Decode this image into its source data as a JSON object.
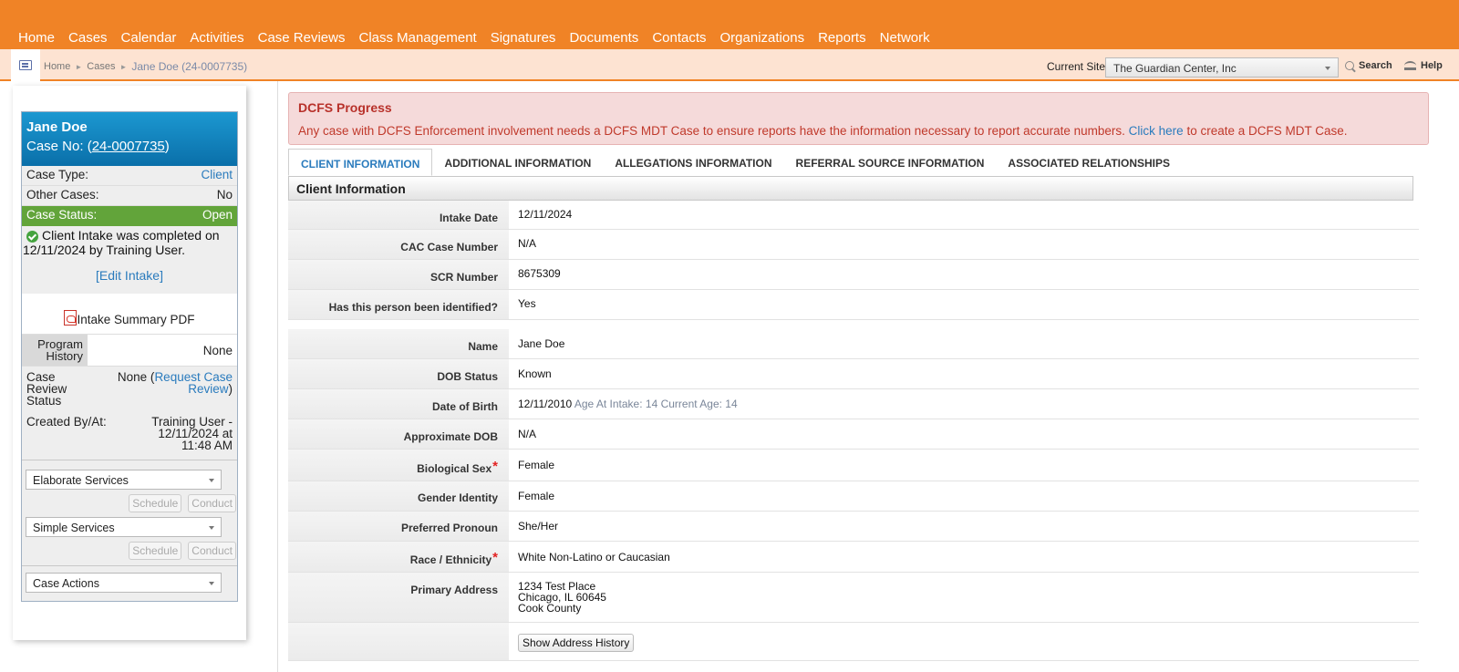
{
  "nav": [
    "Home",
    "Cases",
    "Calendar",
    "Activities",
    "Case Reviews",
    "Class Management",
    "Signatures",
    "Documents",
    "Contacts",
    "Organizations",
    "Reports",
    "Network"
  ],
  "breadcrumb": {
    "home": "Home",
    "cases": "Cases",
    "current": "Jane Doe (24-0007735)"
  },
  "toolbar": {
    "site_label": "Current Site",
    "site_value": "The Guardian Center, Inc",
    "search": "Search",
    "help": "Help"
  },
  "case_card": {
    "name": "Jane Doe",
    "caseno_prefix": "Case No: (",
    "caseno": "24-0007735",
    "caseno_suffix": ")",
    "case_type_label": "Case Type:",
    "case_type": "Client",
    "other_cases_label": "Other Cases:",
    "other_cases": "No",
    "status_label": "Case Status:",
    "status": "Open",
    "intake_note": "Client Intake was completed on 12/11/2024 by Training User.",
    "edit_intake": "[Edit Intake]",
    "pdf": "Intake Summary PDF",
    "program_history_label": "Program History",
    "program_history": "None",
    "review_label": "Case Review Status",
    "review_prefix": "None (",
    "review_link": "Request Case Review",
    "review_suffix": ")",
    "created_label": "Created By/At:",
    "created_value": "Training User - 12/11/2024 at 11:48 AM",
    "services1": "Elaborate Services",
    "services2": "Simple Services",
    "schedule": "Schedule",
    "conduct": "Conduct",
    "case_actions": "Case Actions"
  },
  "alert": {
    "title": "DCFS Progress",
    "msg_before": "Any case with DCFS Enforcement involvement needs a DCFS MDT Case to ensure reports have the information necessary to report accurate numbers.",
    "link": "Click here",
    "msg_after": "to create a DCFS MDT Case."
  },
  "tabs": [
    "CLIENT INFORMATION",
    "ADDITIONAL INFORMATION",
    "ALLEGATIONS INFORMATION",
    "REFERRAL SOURCE INFORMATION",
    "ASSOCIATED RELATIONSHIPS"
  ],
  "section_title": "Client Information",
  "fields": {
    "intake_date_label": "Intake Date",
    "intake_date": "12/11/2024",
    "cac_label": "CAC Case Number",
    "cac": "N/A",
    "scr_label": "SCR Number",
    "scr": "8675309",
    "identified_label": "Has this person been identified?",
    "identified": "Yes",
    "name_label": "Name",
    "name": "Jane Doe",
    "dob_status_label": "DOB Status",
    "dob_status": "Known",
    "dob_label": "Date of Birth",
    "dob": "12/11/2010",
    "dob_ages": "Age At Intake: 14 Current Age: 14",
    "approx_dob_label": "Approximate DOB",
    "approx_dob": "N/A",
    "sex_label": "Biological Sex",
    "sex": "Female",
    "gender_label": "Gender Identity",
    "gender": "Female",
    "pronoun_label": "Preferred Pronoun",
    "pronoun": "She/Her",
    "race_label": "Race / Ethnicity",
    "race": "White Non-Latino or Caucasian",
    "address_label": "Primary Address",
    "address_line1": "1234 Test Place",
    "address_line2": "Chicago, IL 60645",
    "address_line3": "Cook County",
    "address_history_button": "Show Address History",
    "required_mark": "*"
  },
  "colors": {
    "nav": "#f08326",
    "card_head": "#0a6fa9",
    "status_open": "#62a43a",
    "link": "#2a7bbd",
    "alert_bg": "#f5dada"
  }
}
